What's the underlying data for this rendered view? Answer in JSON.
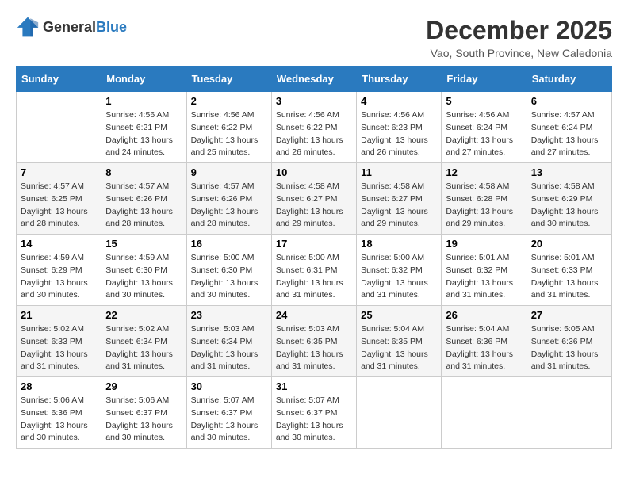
{
  "header": {
    "logo_general": "General",
    "logo_blue": "Blue",
    "title": "December 2025",
    "subtitle": "Vao, South Province, New Caledonia"
  },
  "days_of_week": [
    "Sunday",
    "Monday",
    "Tuesday",
    "Wednesday",
    "Thursday",
    "Friday",
    "Saturday"
  ],
  "weeks": [
    [
      {
        "day": "",
        "content": ""
      },
      {
        "day": "1",
        "content": "Sunrise: 4:56 AM\nSunset: 6:21 PM\nDaylight: 13 hours\nand 24 minutes."
      },
      {
        "day": "2",
        "content": "Sunrise: 4:56 AM\nSunset: 6:22 PM\nDaylight: 13 hours\nand 25 minutes."
      },
      {
        "day": "3",
        "content": "Sunrise: 4:56 AM\nSunset: 6:22 PM\nDaylight: 13 hours\nand 26 minutes."
      },
      {
        "day": "4",
        "content": "Sunrise: 4:56 AM\nSunset: 6:23 PM\nDaylight: 13 hours\nand 26 minutes."
      },
      {
        "day": "5",
        "content": "Sunrise: 4:56 AM\nSunset: 6:24 PM\nDaylight: 13 hours\nand 27 minutes."
      },
      {
        "day": "6",
        "content": "Sunrise: 4:57 AM\nSunset: 6:24 PM\nDaylight: 13 hours\nand 27 minutes."
      }
    ],
    [
      {
        "day": "7",
        "content": "Sunrise: 4:57 AM\nSunset: 6:25 PM\nDaylight: 13 hours\nand 28 minutes."
      },
      {
        "day": "8",
        "content": "Sunrise: 4:57 AM\nSunset: 6:26 PM\nDaylight: 13 hours\nand 28 minutes."
      },
      {
        "day": "9",
        "content": "Sunrise: 4:57 AM\nSunset: 6:26 PM\nDaylight: 13 hours\nand 28 minutes."
      },
      {
        "day": "10",
        "content": "Sunrise: 4:58 AM\nSunset: 6:27 PM\nDaylight: 13 hours\nand 29 minutes."
      },
      {
        "day": "11",
        "content": "Sunrise: 4:58 AM\nSunset: 6:27 PM\nDaylight: 13 hours\nand 29 minutes."
      },
      {
        "day": "12",
        "content": "Sunrise: 4:58 AM\nSunset: 6:28 PM\nDaylight: 13 hours\nand 29 minutes."
      },
      {
        "day": "13",
        "content": "Sunrise: 4:58 AM\nSunset: 6:29 PM\nDaylight: 13 hours\nand 30 minutes."
      }
    ],
    [
      {
        "day": "14",
        "content": "Sunrise: 4:59 AM\nSunset: 6:29 PM\nDaylight: 13 hours\nand 30 minutes."
      },
      {
        "day": "15",
        "content": "Sunrise: 4:59 AM\nSunset: 6:30 PM\nDaylight: 13 hours\nand 30 minutes."
      },
      {
        "day": "16",
        "content": "Sunrise: 5:00 AM\nSunset: 6:30 PM\nDaylight: 13 hours\nand 30 minutes."
      },
      {
        "day": "17",
        "content": "Sunrise: 5:00 AM\nSunset: 6:31 PM\nDaylight: 13 hours\nand 31 minutes."
      },
      {
        "day": "18",
        "content": "Sunrise: 5:00 AM\nSunset: 6:32 PM\nDaylight: 13 hours\nand 31 minutes."
      },
      {
        "day": "19",
        "content": "Sunrise: 5:01 AM\nSunset: 6:32 PM\nDaylight: 13 hours\nand 31 minutes."
      },
      {
        "day": "20",
        "content": "Sunrise: 5:01 AM\nSunset: 6:33 PM\nDaylight: 13 hours\nand 31 minutes."
      }
    ],
    [
      {
        "day": "21",
        "content": "Sunrise: 5:02 AM\nSunset: 6:33 PM\nDaylight: 13 hours\nand 31 minutes."
      },
      {
        "day": "22",
        "content": "Sunrise: 5:02 AM\nSunset: 6:34 PM\nDaylight: 13 hours\nand 31 minutes."
      },
      {
        "day": "23",
        "content": "Sunrise: 5:03 AM\nSunset: 6:34 PM\nDaylight: 13 hours\nand 31 minutes."
      },
      {
        "day": "24",
        "content": "Sunrise: 5:03 AM\nSunset: 6:35 PM\nDaylight: 13 hours\nand 31 minutes."
      },
      {
        "day": "25",
        "content": "Sunrise: 5:04 AM\nSunset: 6:35 PM\nDaylight: 13 hours\nand 31 minutes."
      },
      {
        "day": "26",
        "content": "Sunrise: 5:04 AM\nSunset: 6:36 PM\nDaylight: 13 hours\nand 31 minutes."
      },
      {
        "day": "27",
        "content": "Sunrise: 5:05 AM\nSunset: 6:36 PM\nDaylight: 13 hours\nand 31 minutes."
      }
    ],
    [
      {
        "day": "28",
        "content": "Sunrise: 5:06 AM\nSunset: 6:36 PM\nDaylight: 13 hours\nand 30 minutes."
      },
      {
        "day": "29",
        "content": "Sunrise: 5:06 AM\nSunset: 6:37 PM\nDaylight: 13 hours\nand 30 minutes."
      },
      {
        "day": "30",
        "content": "Sunrise: 5:07 AM\nSunset: 6:37 PM\nDaylight: 13 hours\nand 30 minutes."
      },
      {
        "day": "31",
        "content": "Sunrise: 5:07 AM\nSunset: 6:37 PM\nDaylight: 13 hours\nand 30 minutes."
      },
      {
        "day": "",
        "content": ""
      },
      {
        "day": "",
        "content": ""
      },
      {
        "day": "",
        "content": ""
      }
    ]
  ]
}
